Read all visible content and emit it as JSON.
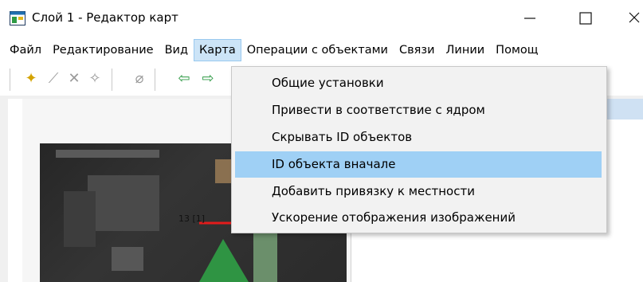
{
  "window": {
    "title": "Слой 1 - Редактор карт"
  },
  "menubar": {
    "items": [
      "Файл",
      "Редактирование",
      "Вид",
      "Карта",
      "Операции с объектами",
      "Связи",
      "Линии",
      "Помощ"
    ],
    "active_index": 3
  },
  "dropdown": {
    "items": [
      "Общие установки",
      "Привести в соответствие с ядром",
      "Скрывать ID объектов",
      "ID объекта вначале",
      "Добавить привязку к местности",
      "Ускорение отображения изображений"
    ],
    "highlight_index": 3
  },
  "map": {
    "label": "13 [1]"
  },
  "icons": {
    "toolbar": [
      "add-point-icon",
      "draw-line-icon",
      "delete-icon",
      "tool-icon",
      "eraser-icon",
      "undo-icon",
      "redo-icon"
    ]
  },
  "colors": {
    "menu_active": "#cce4f7",
    "dropdown_highlight": "#9fd0f5",
    "marker_red": "#e31b1b",
    "green_area": "#2f9a45"
  }
}
